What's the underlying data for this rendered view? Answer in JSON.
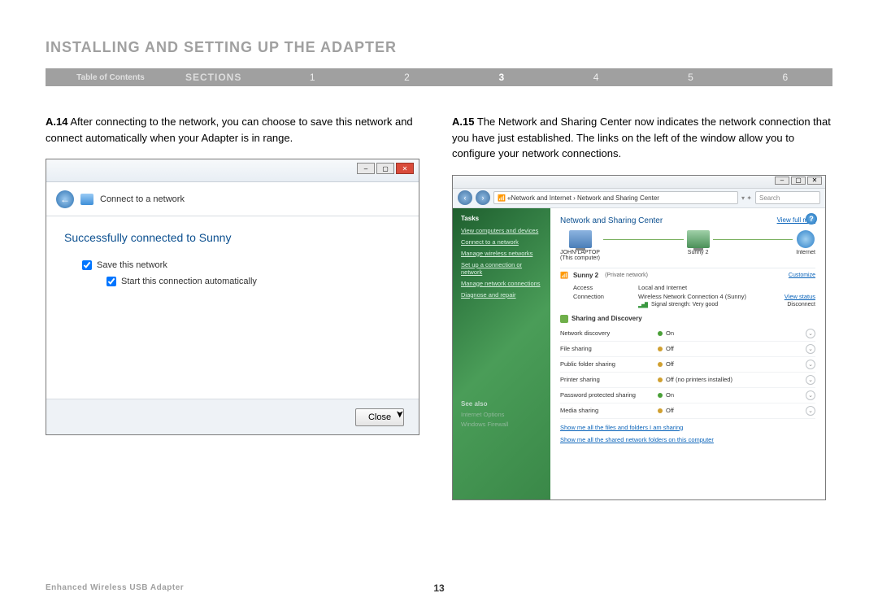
{
  "page": {
    "title": "INSTALLING AND SETTING UP THE ADAPTER",
    "product": "Enhanced Wireless USB Adapter",
    "number": "13"
  },
  "nav": {
    "toc": "Table of Contents",
    "sections_label": "SECTIONS",
    "items": [
      "1",
      "2",
      "3",
      "4",
      "5",
      "6"
    ],
    "active": "3"
  },
  "steps": {
    "a14_num": "A.14",
    "a14_text": " After connecting to the network, you can choose to save this network and connect automatically when your Adapter is in range.",
    "a15_num": "A.15",
    "a15_text": " The Network and Sharing Center now indicates the network connection that you have just established. The links on the left of the window allow you to configure your network connections."
  },
  "ss1": {
    "header": "Connect to a network",
    "success": "Successfully connected to Sunny",
    "cb1": "Save this network",
    "cb2": "Start this connection automatically",
    "close": "Close"
  },
  "ss2": {
    "breadcrumb": "Network and Internet  ›  Network and Sharing Center",
    "search": "Search",
    "tasks_h": "Tasks",
    "tasks": [
      "View computers and devices",
      "Connect to a network",
      "Manage wireless networks",
      "Set up a connection or network",
      "Manage network connections",
      "Diagnose and repair"
    ],
    "seealso_h": "See also",
    "seealso": [
      "Internet Options",
      "Windows Firewall"
    ],
    "title": "Network and Sharing Center",
    "fullmap": "View full map",
    "node1": "JOHN-LAPTOP",
    "node1sub": "(This computer)",
    "node2": "Sunny 2",
    "node3": "Internet",
    "netname": "Sunny 2",
    "nettype": "(Private network)",
    "customize": "Customize",
    "access_k": "Access",
    "access_v": "Local and Internet",
    "conn_k": "Connection",
    "conn_v": "Wireless Network Connection 4 (Sunny)",
    "viewstatus": "View status",
    "signal": "Signal strength: Very good",
    "disconnect": "Disconnect",
    "sharing_h": "Sharing and Discovery",
    "rows": [
      {
        "k": "Network discovery",
        "v": "On",
        "on": true
      },
      {
        "k": "File sharing",
        "v": "Off",
        "on": false
      },
      {
        "k": "Public folder sharing",
        "v": "Off",
        "on": false
      },
      {
        "k": "Printer sharing",
        "v": "Off (no printers installed)",
        "on": false
      },
      {
        "k": "Password protected sharing",
        "v": "On",
        "on": true
      },
      {
        "k": "Media sharing",
        "v": "Off",
        "on": false
      }
    ],
    "link1": "Show me all the files and folders I am sharing",
    "link2": "Show me all the shared network folders on this computer"
  }
}
